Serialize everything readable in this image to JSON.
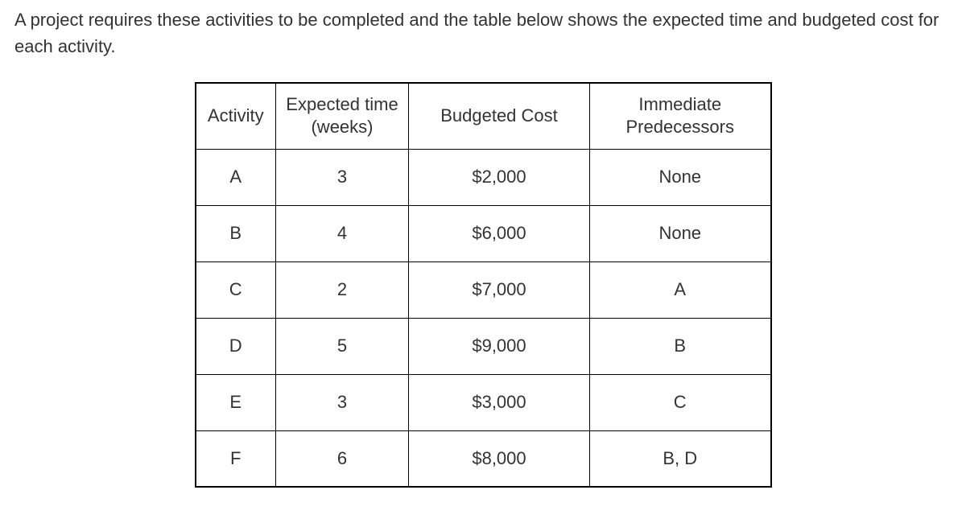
{
  "intro": "A project requires these activities to be completed and the table below shows the expected time and budgeted cost for each activity.",
  "chart_data": {
    "type": "table",
    "headers": {
      "activity": "Activity",
      "expected_time": "Expected time (weeks)",
      "budgeted_cost": "Budgeted Cost",
      "predecessors": "Immediate Predecessors"
    },
    "header_lines": {
      "expected_time_line1": "Expected time",
      "expected_time_line2": "(weeks)",
      "predecessors_line1": "Immediate",
      "predecessors_line2": "Predecessors"
    },
    "rows": [
      {
        "activity": "A",
        "expected_time": "3",
        "budgeted_cost": "$2,000",
        "predecessors": "None"
      },
      {
        "activity": "B",
        "expected_time": "4",
        "budgeted_cost": "$6,000",
        "predecessors": "None"
      },
      {
        "activity": "C",
        "expected_time": "2",
        "budgeted_cost": "$7,000",
        "predecessors": "A"
      },
      {
        "activity": "D",
        "expected_time": "5",
        "budgeted_cost": "$9,000",
        "predecessors": "B"
      },
      {
        "activity": "E",
        "expected_time": "3",
        "budgeted_cost": "$3,000",
        "predecessors": "C"
      },
      {
        "activity": "F",
        "expected_time": "6",
        "budgeted_cost": "$8,000",
        "predecessors": "B, D"
      }
    ]
  }
}
